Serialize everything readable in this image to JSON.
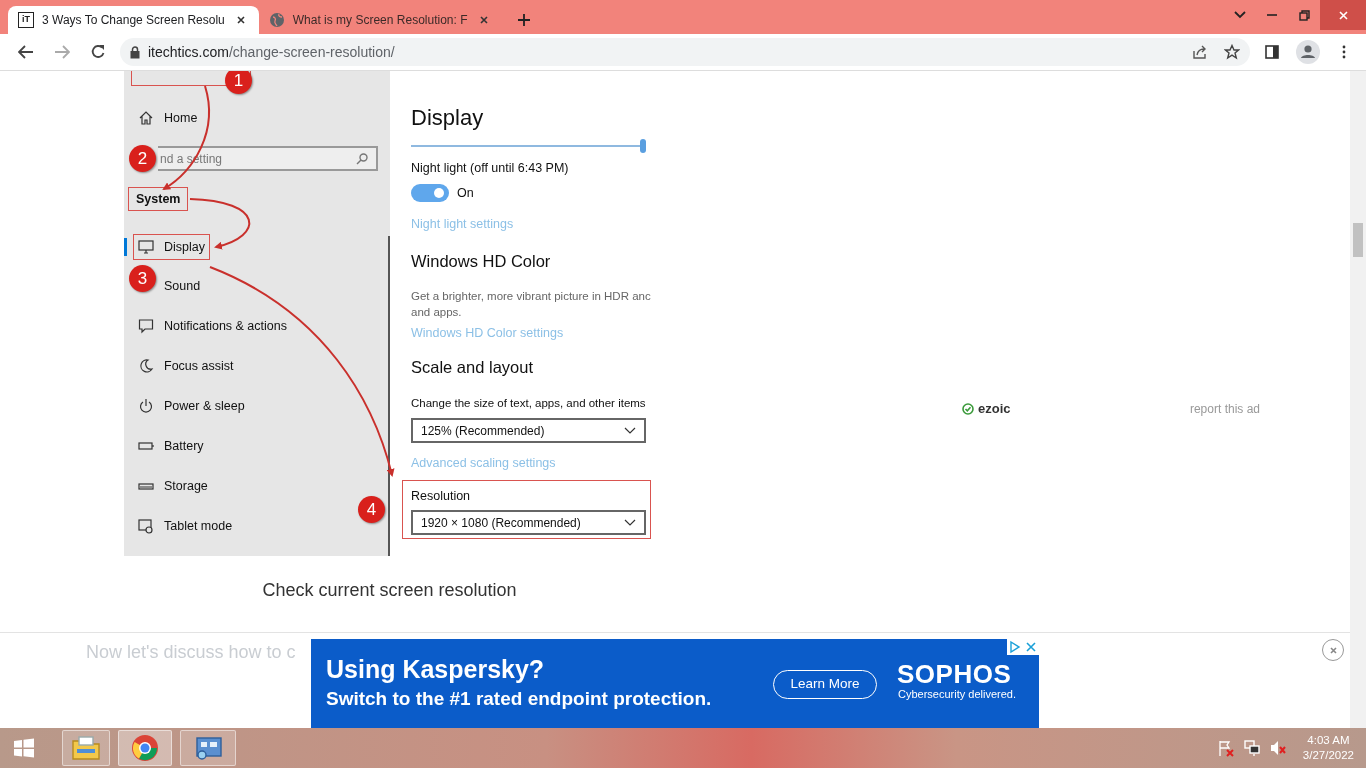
{
  "browser": {
    "tabs": [
      {
        "title": "3 Ways To Change Screen Resolu",
        "favicon_text": "iT",
        "selected": true
      },
      {
        "title": "What is my Screen Resolution: F",
        "selected": false
      }
    ],
    "url_domain": "itechtics.com",
    "url_path": "/change-screen-resolution/"
  },
  "screenshot": {
    "sidebar": {
      "home": "Home",
      "search_placeholder": "nd a setting",
      "section": "System",
      "section_highlighted": true,
      "items": [
        {
          "label": "Display",
          "selected": true,
          "highlighted": true
        },
        {
          "label": "Sound",
          "selected": false,
          "highlighted": false
        },
        {
          "label": "Notifications & actions",
          "selected": false,
          "highlighted": false
        },
        {
          "label": "Focus assist",
          "selected": false,
          "highlighted": false
        },
        {
          "label": "Power & sleep",
          "selected": false,
          "highlighted": false
        },
        {
          "label": "Battery",
          "selected": false,
          "highlighted": false
        },
        {
          "label": "Storage",
          "selected": false,
          "highlighted": false
        },
        {
          "label": "Tablet mode",
          "selected": false,
          "highlighted": false
        }
      ]
    },
    "panel": {
      "title": "Display",
      "brightness": {
        "level": 1.0
      },
      "night_light": {
        "label": "Night light (off until 6:43 PM)",
        "on": true,
        "state_text": "On",
        "link": "Night light settings"
      },
      "hd_color": {
        "heading": "Windows HD Color",
        "description": [
          "Get a brighter, more vibrant picture in HDR anc",
          "and apps."
        ],
        "link": "Windows HD Color settings"
      },
      "scale": {
        "heading": "Scale and layout",
        "label": "Change the size of text, apps, and other items",
        "value": "125% (Recommended)",
        "link": "Advanced scaling settings"
      },
      "resolution": {
        "label": "Resolution",
        "value": "1920 × 1080 (Recommended)",
        "highlighted": true
      }
    },
    "annotations": [
      "1",
      "2",
      "3",
      "4"
    ]
  },
  "caption": "Check current screen resolution",
  "ad_notice": {
    "brand": "ezoic",
    "report": "report this ad"
  },
  "body_text": "Now let's discuss how to c",
  "banner": {
    "headline": "Using Kaspersky?",
    "subline": "Switch to the #1 rated endpoint protection.",
    "button": "Learn More",
    "brand": "SOPHOS",
    "tagline": "Cybersecurity delivered."
  },
  "taskbar": {
    "time": "4:03 AM",
    "date": "3/27/2022"
  }
}
